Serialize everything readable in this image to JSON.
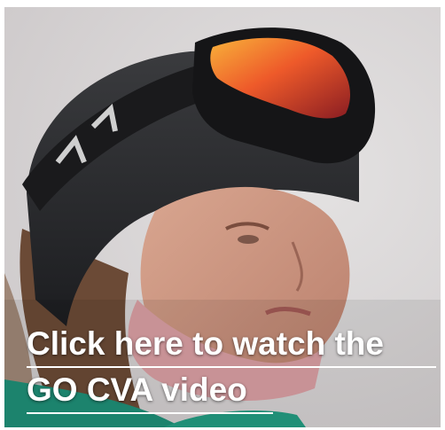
{
  "video_promo": {
    "image_alt": "Snowboarder wearing a helmet and goggles",
    "link_line_1": "Click here to watch the",
    "link_line_2": "GO CVA video"
  },
  "colors": {
    "link_text": "#ffffff",
    "background": "#d9d7d8"
  }
}
